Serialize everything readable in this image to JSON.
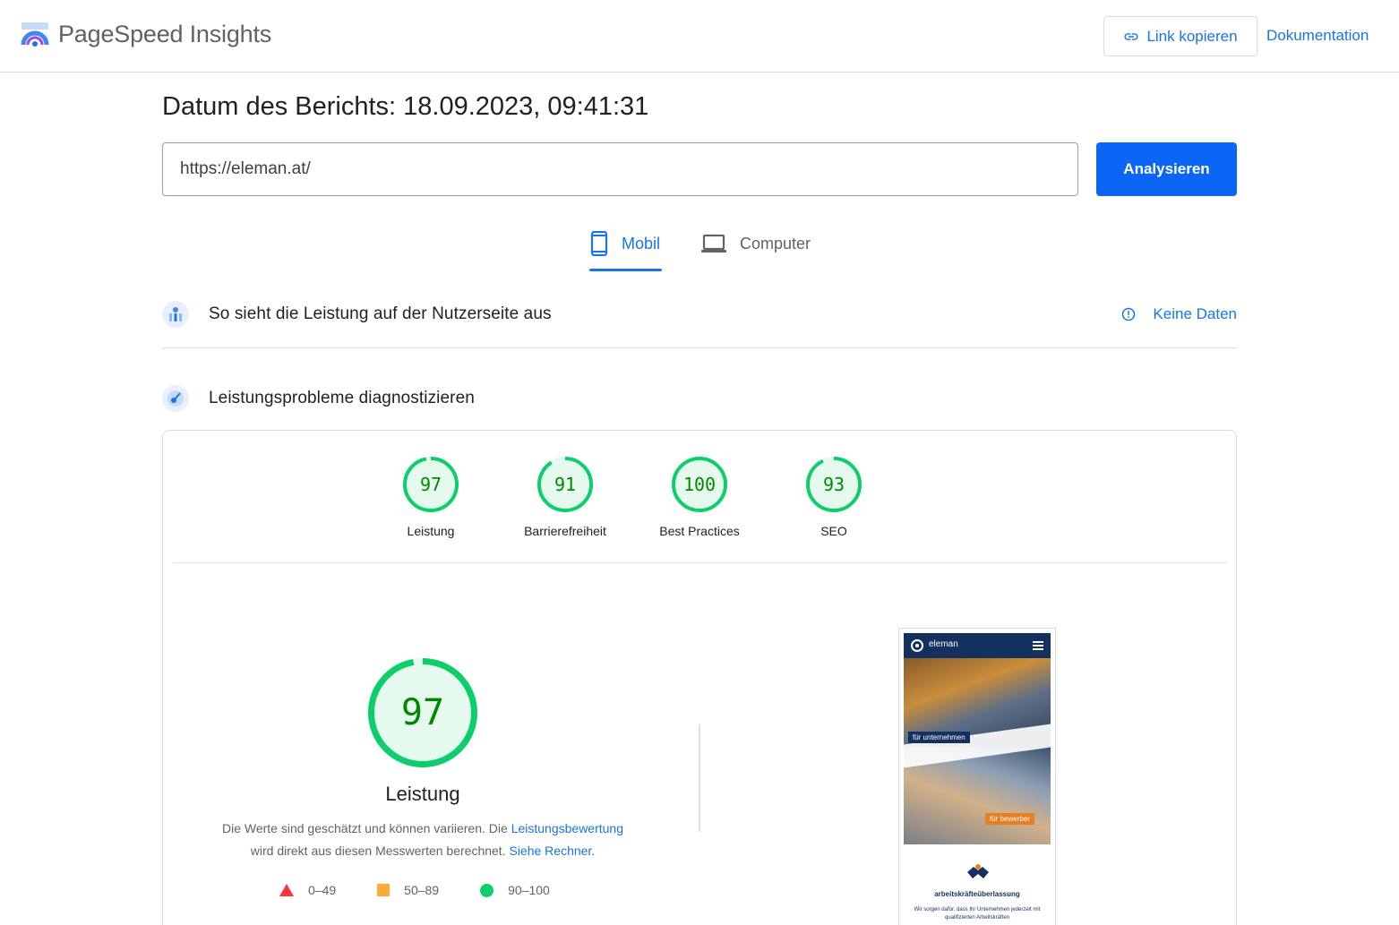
{
  "header": {
    "app_title": "PageSpeed Insights",
    "copy_link_label": "Link kopieren",
    "docs_label": "Dokumentation"
  },
  "report": {
    "date_label": "Datum des Berichts: 18.09.2023, 09:41:31",
    "url_value": "https://eleman.at/",
    "analyze_label": "Analysieren"
  },
  "tabs": [
    {
      "label": "Mobil",
      "active": true
    },
    {
      "label": "Computer",
      "active": false
    }
  ],
  "sections": {
    "field": {
      "title": "So sieht die Leistung auf der Nutzerseite aus",
      "status": "Keine Daten"
    },
    "lab": {
      "title": "Leistungsprobleme diagnostizieren"
    }
  },
  "scores": [
    {
      "label": "Leistung",
      "value": "97",
      "fraction": 0.97
    },
    {
      "label": "Barrierefreiheit",
      "value": "91",
      "fraction": 0.91
    },
    {
      "label": "Best Practices",
      "value": "100",
      "fraction": 1.0
    },
    {
      "label": "SEO",
      "value": "93",
      "fraction": 0.93
    }
  ],
  "performance": {
    "value": "97",
    "fraction": 0.97,
    "label": "Leistung",
    "desc_part1": "Die Werte sind geschätzt und können variieren. Die ",
    "desc_link1": "Leistungsbewertung",
    "desc_part2": "wird direkt aus diesen Messwerten berechnet. ",
    "desc_link2": "Siehe Rechner."
  },
  "legend": [
    {
      "range": "0–49",
      "color": "#ff3333",
      "shape": "triangle"
    },
    {
      "range": "50–89",
      "color": "#ffaa33",
      "shape": "square"
    },
    {
      "range": "90–100",
      "color": "#0cce6b",
      "shape": "circle"
    }
  ],
  "screenshot": {
    "brand": "eleman",
    "tag_companies": "für unternehmen",
    "tag_applicants": "für bewerber",
    "heading": "arbeitskräfteüberlassung",
    "text": "Wir sorgen dafür, dass Ihr Unternehmen jederzeit mit qualifizierten Arbeitskräften"
  },
  "colors": {
    "accent": "#1a73e8",
    "primary_button": "#0b66f5",
    "pass": "#0cce6b",
    "pass_text": "#008800",
    "pass_fill": "#e6f9ee"
  }
}
